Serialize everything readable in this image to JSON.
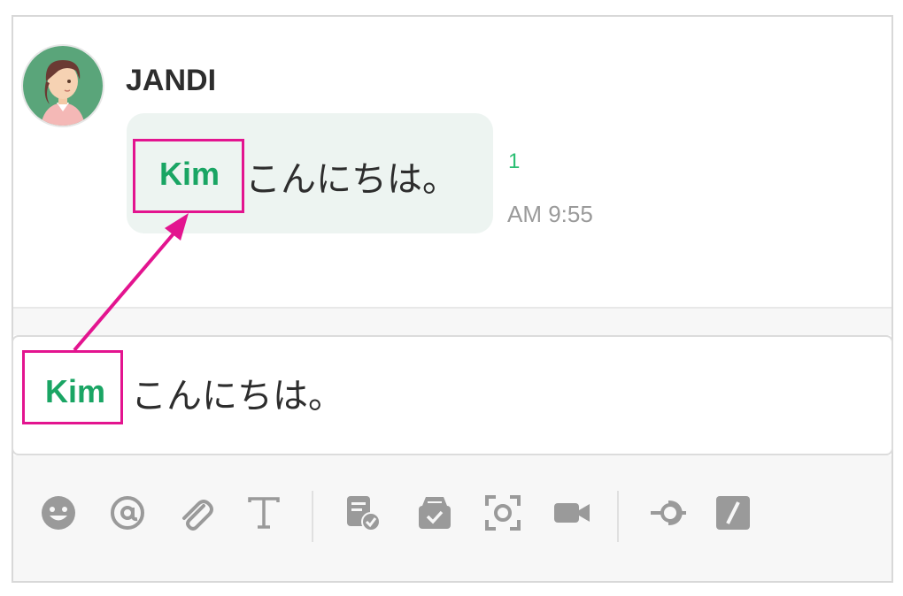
{
  "message": {
    "sender": "JANDI",
    "mention": "Kim",
    "text": "こんにちは。",
    "unread_count": "1",
    "time": "AM 9:55"
  },
  "composer": {
    "mention": "Kim",
    "text": "こんにちは。"
  },
  "toolbar": {
    "icons": [
      "emoji-icon",
      "mention-icon",
      "attach-icon",
      "text-format-icon",
      "todo-icon",
      "archive-icon",
      "screenshot-icon",
      "video-call-icon",
      "integration-icon",
      "slash-command-icon"
    ]
  },
  "colors": {
    "mention": "#1aa564",
    "highlight": "#e3148f",
    "bubble": "#edf4f1",
    "icon": "#9a9a9a"
  }
}
